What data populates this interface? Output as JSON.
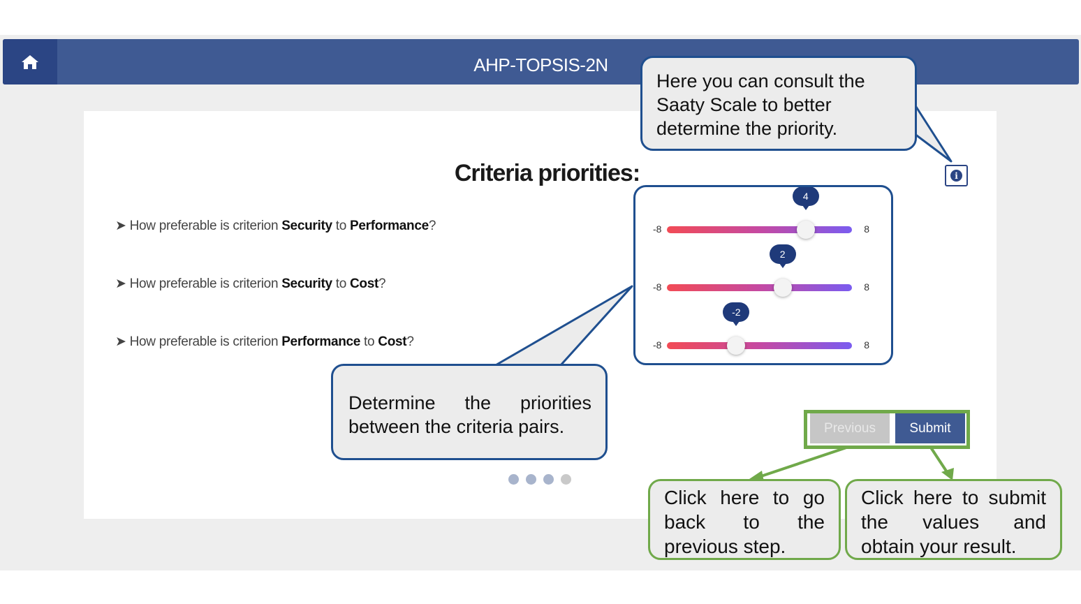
{
  "app": {
    "title": "AHP-TOPSIS-2N"
  },
  "card": {
    "title": "Criteria priorities:"
  },
  "questions": [
    {
      "prefix": "How preferable is criterion ",
      "a": "Security",
      "mid": " to ",
      "b": "Performance",
      "suffix": "?"
    },
    {
      "prefix": "How preferable is criterion ",
      "a": "Security",
      "mid": " to ",
      "b": "Cost",
      "suffix": "?"
    },
    {
      "prefix": "How preferable is criterion ",
      "a": "Performance",
      "mid": " to ",
      "b": "Cost",
      "suffix": "?"
    }
  ],
  "sliders": [
    {
      "min": "-8",
      "max": "8",
      "value": 4,
      "label": "4"
    },
    {
      "min": "-8",
      "max": "8",
      "value": 2,
      "label": "2"
    },
    {
      "min": "-8",
      "max": "8",
      "value": -2,
      "label": "-2"
    }
  ],
  "buttons": {
    "previous": "Previous",
    "submit": "Submit"
  },
  "pagination": {
    "steps": 4
  },
  "callouts": {
    "info": "Here you can consult the Saaty Scale to better determine the priority.",
    "priorities": "Determine the priorities between the criteria pairs.",
    "previous": "Click here to go back to the previous step.",
    "submit": "Click here to submit the values and obtain your result."
  },
  "colors": {
    "navbar": "#3f5a93",
    "home_button": "#2b4584",
    "callout_blue": "#1f4f8f",
    "callout_green": "#70a94a"
  },
  "icons": {
    "home": "home-icon",
    "info": "info-icon",
    "question_marker": "arrow-right-icon"
  }
}
